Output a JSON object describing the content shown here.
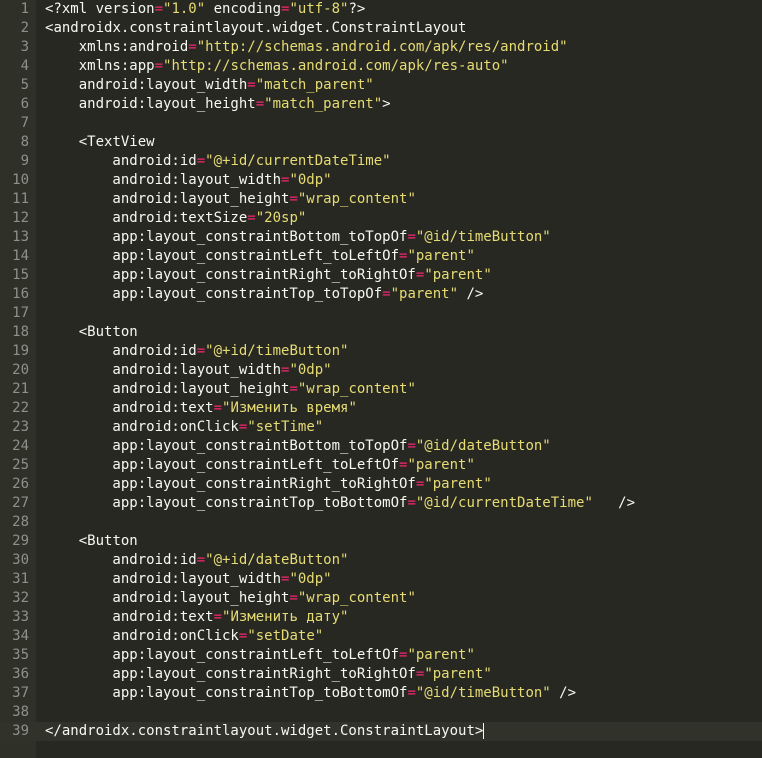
{
  "editor": {
    "language": "XML",
    "current_line": 39,
    "colors": {
      "background": "#272822",
      "gutter": "#2f3129",
      "text": "#f8f8f2",
      "string": "#e6db74",
      "operator": "#f92672",
      "line_number": "#8f908a"
    },
    "lines": [
      {
        "n": "1",
        "t": [
          [
            "pi",
            "<?xml version"
          ],
          [
            "eq",
            "="
          ],
          [
            "str",
            "\"1.0\""
          ],
          [
            "pi",
            " encoding"
          ],
          [
            "eq",
            "="
          ],
          [
            "str",
            "\"utf-8\""
          ],
          [
            "pi",
            "?>"
          ]
        ]
      },
      {
        "n": "2",
        "t": [
          [
            "brk",
            "<"
          ],
          [
            "tag",
            "androidx.constraintlayout.widget.ConstraintLayout"
          ]
        ]
      },
      {
        "n": "3",
        "t": [
          [
            "attr",
            "    xmlns:android"
          ],
          [
            "eq",
            "="
          ],
          [
            "str",
            "\"http://schemas.android.com/apk/res/android\""
          ]
        ]
      },
      {
        "n": "4",
        "t": [
          [
            "attr",
            "    xmlns:app"
          ],
          [
            "eq",
            "="
          ],
          [
            "str",
            "\"http://schemas.android.com/apk/res-auto\""
          ]
        ]
      },
      {
        "n": "5",
        "t": [
          [
            "attr",
            "    android:layout_width"
          ],
          [
            "eq",
            "="
          ],
          [
            "str",
            "\"match_parent\""
          ]
        ]
      },
      {
        "n": "6",
        "t": [
          [
            "attr",
            "    android:layout_height"
          ],
          [
            "eq",
            "="
          ],
          [
            "str",
            "\"match_parent\""
          ],
          [
            "brk",
            ">"
          ]
        ]
      },
      {
        "n": "7",
        "t": []
      },
      {
        "n": "8",
        "t": [
          [
            "brk",
            "    <"
          ],
          [
            "tag",
            "TextView"
          ]
        ]
      },
      {
        "n": "9",
        "t": [
          [
            "attr",
            "        android:id"
          ],
          [
            "eq",
            "="
          ],
          [
            "str",
            "\"@+id/currentDateTime\""
          ]
        ]
      },
      {
        "n": "10",
        "t": [
          [
            "attr",
            "        android:layout_width"
          ],
          [
            "eq",
            "="
          ],
          [
            "str",
            "\"0dp\""
          ]
        ]
      },
      {
        "n": "11",
        "t": [
          [
            "attr",
            "        android:layout_height"
          ],
          [
            "eq",
            "="
          ],
          [
            "str",
            "\"wrap_content\""
          ]
        ]
      },
      {
        "n": "12",
        "t": [
          [
            "attr",
            "        android:textSize"
          ],
          [
            "eq",
            "="
          ],
          [
            "str",
            "\"20sp\""
          ]
        ]
      },
      {
        "n": "13",
        "t": [
          [
            "attr",
            "        app:layout_constraintBottom_toTopOf"
          ],
          [
            "eq",
            "="
          ],
          [
            "str",
            "\"@id/timeButton\""
          ]
        ]
      },
      {
        "n": "14",
        "t": [
          [
            "attr",
            "        app:layout_constraintLeft_toLeftOf"
          ],
          [
            "eq",
            "="
          ],
          [
            "str",
            "\"parent\""
          ]
        ]
      },
      {
        "n": "15",
        "t": [
          [
            "attr",
            "        app:layout_constraintRight_toRightOf"
          ],
          [
            "eq",
            "="
          ],
          [
            "str",
            "\"parent\""
          ]
        ]
      },
      {
        "n": "16",
        "t": [
          [
            "attr",
            "        app:layout_constraintTop_toTopOf"
          ],
          [
            "eq",
            "="
          ],
          [
            "str",
            "\"parent\""
          ],
          [
            "brk",
            " />"
          ]
        ]
      },
      {
        "n": "17",
        "t": []
      },
      {
        "n": "18",
        "t": [
          [
            "brk",
            "    <"
          ],
          [
            "tag",
            "Button"
          ]
        ]
      },
      {
        "n": "19",
        "t": [
          [
            "attr",
            "        android:id"
          ],
          [
            "eq",
            "="
          ],
          [
            "str",
            "\"@+id/timeButton\""
          ]
        ]
      },
      {
        "n": "20",
        "t": [
          [
            "attr",
            "        android:layout_width"
          ],
          [
            "eq",
            "="
          ],
          [
            "str",
            "\"0dp\""
          ]
        ]
      },
      {
        "n": "21",
        "t": [
          [
            "attr",
            "        android:layout_height"
          ],
          [
            "eq",
            "="
          ],
          [
            "str",
            "\"wrap_content\""
          ]
        ]
      },
      {
        "n": "22",
        "t": [
          [
            "attr",
            "        android:text"
          ],
          [
            "eq",
            "="
          ],
          [
            "str",
            "\"Изменить время\""
          ]
        ]
      },
      {
        "n": "23",
        "t": [
          [
            "attr",
            "        android:onClick"
          ],
          [
            "eq",
            "="
          ],
          [
            "str",
            "\"setTime\""
          ]
        ]
      },
      {
        "n": "24",
        "t": [
          [
            "attr",
            "        app:layout_constraintBottom_toTopOf"
          ],
          [
            "eq",
            "="
          ],
          [
            "str",
            "\"@id/dateButton\""
          ]
        ]
      },
      {
        "n": "25",
        "t": [
          [
            "attr",
            "        app:layout_constraintLeft_toLeftOf"
          ],
          [
            "eq",
            "="
          ],
          [
            "str",
            "\"parent\""
          ]
        ]
      },
      {
        "n": "26",
        "t": [
          [
            "attr",
            "        app:layout_constraintRight_toRightOf"
          ],
          [
            "eq",
            "="
          ],
          [
            "str",
            "\"parent\""
          ]
        ]
      },
      {
        "n": "27",
        "t": [
          [
            "attr",
            "        app:layout_constraintTop_toBottomOf"
          ],
          [
            "eq",
            "="
          ],
          [
            "str",
            "\"@id/currentDateTime\""
          ],
          [
            "brk",
            "   />"
          ]
        ]
      },
      {
        "n": "28",
        "t": []
      },
      {
        "n": "29",
        "t": [
          [
            "brk",
            "    <"
          ],
          [
            "tag",
            "Button"
          ]
        ]
      },
      {
        "n": "30",
        "t": [
          [
            "attr",
            "        android:id"
          ],
          [
            "eq",
            "="
          ],
          [
            "str",
            "\"@+id/dateButton\""
          ]
        ]
      },
      {
        "n": "31",
        "t": [
          [
            "attr",
            "        android:layout_width"
          ],
          [
            "eq",
            "="
          ],
          [
            "str",
            "\"0dp\""
          ]
        ]
      },
      {
        "n": "32",
        "t": [
          [
            "attr",
            "        android:layout_height"
          ],
          [
            "eq",
            "="
          ],
          [
            "str",
            "\"wrap_content\""
          ]
        ]
      },
      {
        "n": "33",
        "t": [
          [
            "attr",
            "        android:text"
          ],
          [
            "eq",
            "="
          ],
          [
            "str",
            "\"Изменить дату\""
          ]
        ]
      },
      {
        "n": "34",
        "t": [
          [
            "attr",
            "        android:onClick"
          ],
          [
            "eq",
            "="
          ],
          [
            "str",
            "\"setDate\""
          ]
        ]
      },
      {
        "n": "35",
        "t": [
          [
            "attr",
            "        app:layout_constraintLeft_toLeftOf"
          ],
          [
            "eq",
            "="
          ],
          [
            "str",
            "\"parent\""
          ]
        ]
      },
      {
        "n": "36",
        "t": [
          [
            "attr",
            "        app:layout_constraintRight_toRightOf"
          ],
          [
            "eq",
            "="
          ],
          [
            "str",
            "\"parent\""
          ]
        ]
      },
      {
        "n": "37",
        "t": [
          [
            "attr",
            "        app:layout_constraintTop_toBottomOf"
          ],
          [
            "eq",
            "="
          ],
          [
            "str",
            "\"@id/timeButton\""
          ],
          [
            "brk",
            " />"
          ]
        ]
      },
      {
        "n": "38",
        "t": []
      },
      {
        "n": "39",
        "t": [
          [
            "brk",
            "</"
          ],
          [
            "tag",
            "androidx.constraintlayout.widget.ConstraintLayout"
          ],
          [
            "brk",
            ">"
          ]
        ]
      }
    ]
  }
}
